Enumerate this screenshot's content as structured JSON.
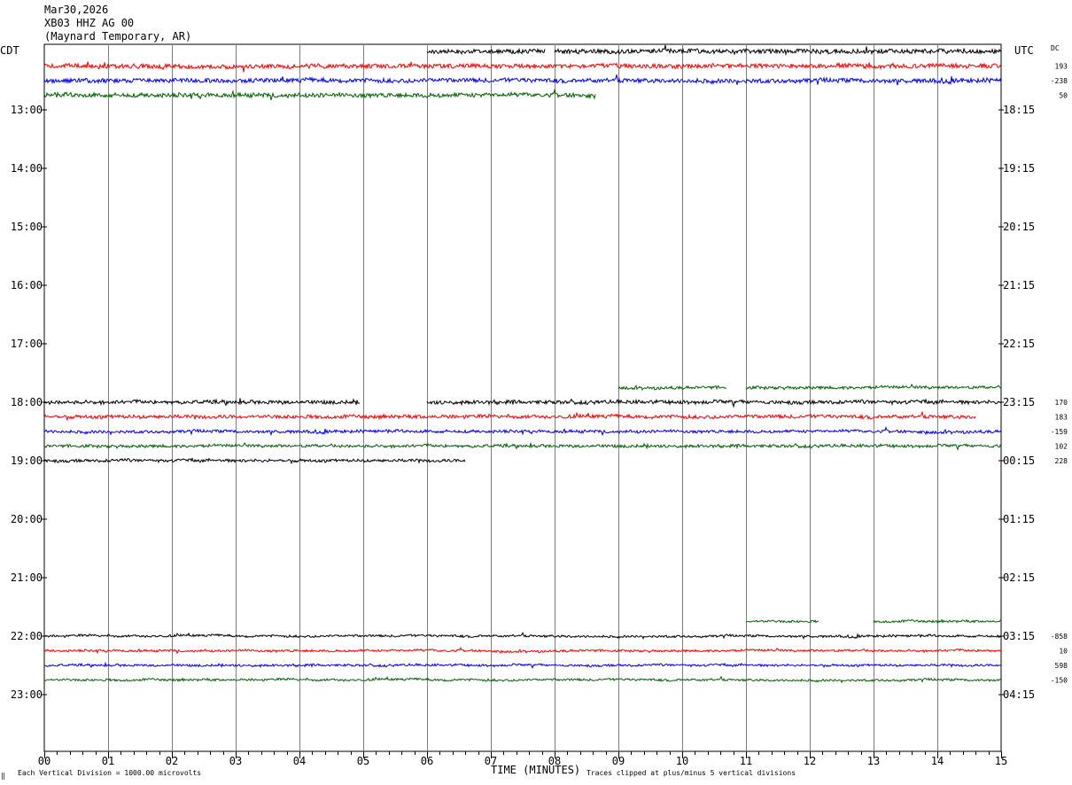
{
  "header": {
    "date": "Mar30,2026",
    "station": "XB03 HHZ AG 00",
    "location": "(Maynard Temporary, AR)"
  },
  "labels": {
    "left_tz": "CDT",
    "right_tz": "UTC",
    "dc": "DC",
    "xlabel": "TIME (MINUTES)",
    "footer_left": "Each Vertical Division = 1000.00 microvolts",
    "footer_right": "Traces clipped at plus/minus 5 vertical divisions",
    "corner_mark": "‖"
  },
  "colors": {
    "black": "#000000",
    "red": "#ff0000",
    "blue": "#0000ff",
    "green": "#006400",
    "grid": "#808080"
  },
  "chart_data": {
    "type": "line",
    "title": "XB03 HHZ AG 00 (Maynard Temporary, AR)",
    "xlabel": "TIME (MINUTES)",
    "xlim": [
      0,
      15
    ],
    "x_ticks": [
      "00",
      "01",
      "02",
      "03",
      "04",
      "05",
      "06",
      "07",
      "08",
      "09",
      "10",
      "11",
      "12",
      "13",
      "14",
      "15"
    ],
    "rows_per_hour": 4,
    "row_minutes": 15,
    "hours_shown": 12,
    "left_hour_labels": [
      "13:00",
      "14:00",
      "15:00",
      "16:00",
      "17:00",
      "18:00",
      "19:00",
      "20:00",
      "21:00",
      "22:00",
      "23:00"
    ],
    "right_hour_labels": [
      "18:15",
      "19:15",
      "20:15",
      "21:15",
      "22:15",
      "23:15",
      "00:15",
      "01:15",
      "02:15",
      "03:15",
      "04:15"
    ],
    "row_colors": [
      "black",
      "red",
      "blue",
      "green"
    ],
    "dc_offsets": [
      {
        "row": 1,
        "value": "193"
      },
      {
        "row": 2,
        "value": "-238"
      },
      {
        "row": 3,
        "value": "50"
      },
      {
        "row": 24,
        "value": "170"
      },
      {
        "row": 25,
        "value": "183"
      },
      {
        "row": 26,
        "value": "-159"
      },
      {
        "row": 27,
        "value": "102"
      },
      {
        "row": 28,
        "value": "228"
      },
      {
        "row": 40,
        "value": "-858"
      },
      {
        "row": 41,
        "value": "10"
      },
      {
        "row": 42,
        "value": "598"
      },
      {
        "row": 43,
        "value": "-150"
      }
    ],
    "traces": [
      {
        "row": 0,
        "segments": [
          [
            6.0,
            7.85
          ],
          [
            8.0,
            15.0
          ]
        ],
        "amp": 3
      },
      {
        "row": 1,
        "segments": [
          [
            0,
            15.0
          ]
        ],
        "amp": 3
      },
      {
        "row": 2,
        "segments": [
          [
            0,
            15.0
          ]
        ],
        "amp": 3
      },
      {
        "row": 3,
        "segments": [
          [
            0,
            8.65
          ]
        ],
        "amp": 3
      },
      {
        "row": 23,
        "segments": [
          [
            9.0,
            10.7
          ],
          [
            11.0,
            15.0
          ]
        ],
        "amp": 2
      },
      {
        "row": 24,
        "segments": [
          [
            0,
            4.95
          ],
          [
            6.0,
            15.0
          ]
        ],
        "amp": 2.5
      },
      {
        "row": 25,
        "segments": [
          [
            0,
            14.6
          ]
        ],
        "amp": 2.5
      },
      {
        "row": 26,
        "segments": [
          [
            0,
            15.0
          ]
        ],
        "amp": 2
      },
      {
        "row": 27,
        "segments": [
          [
            0,
            15.0
          ]
        ],
        "amp": 2
      },
      {
        "row": 28,
        "segments": [
          [
            0,
            6.6
          ]
        ],
        "amp": 2
      },
      {
        "row": 39,
        "segments": [
          [
            11.0,
            12.15
          ],
          [
            13.0,
            15.0
          ]
        ],
        "amp": 1.5
      },
      {
        "row": 40,
        "segments": [
          [
            0,
            15.0
          ]
        ],
        "amp": 1.5
      },
      {
        "row": 41,
        "segments": [
          [
            0,
            15.0
          ]
        ],
        "amp": 1.5
      },
      {
        "row": 42,
        "segments": [
          [
            0,
            15.0
          ]
        ],
        "amp": 1.5
      },
      {
        "row": 43,
        "segments": [
          [
            0,
            15.0
          ]
        ],
        "amp": 1.5
      }
    ]
  }
}
